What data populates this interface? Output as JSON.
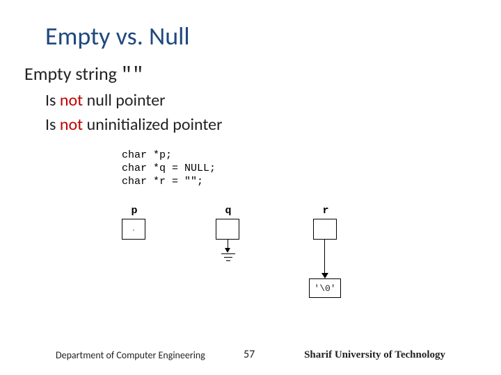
{
  "title": "Empty vs. Null",
  "bullet_char": "",
  "line1_a": "Empty string ",
  "line1_mono": "\"\"",
  "sub1_a": "Is ",
  "sub1_red": "not",
  "sub1_b": " null pointer",
  "sub2_a": "Is ",
  "sub2_red": "not",
  "sub2_b": " uninitialized pointer",
  "code_l1": "char *p;",
  "code_l2": "char *q = NULL;",
  "code_l3": "char *r = \"\";",
  "diagram": {
    "p_label": "p",
    "p_content": "·",
    "q_label": "q",
    "r_label": "r",
    "r_target": "'\\0'"
  },
  "footer": {
    "dept": "Department of Computer Engineering",
    "page": "57",
    "uni": "Sharif University of Technology"
  }
}
